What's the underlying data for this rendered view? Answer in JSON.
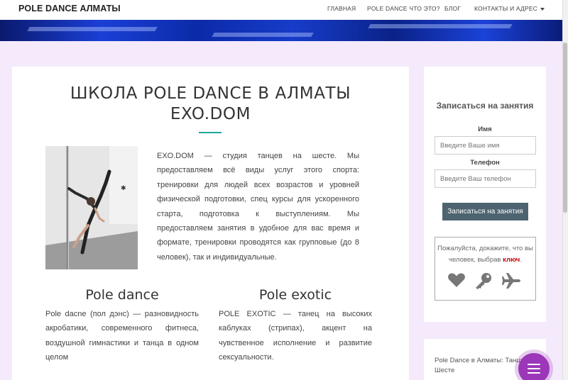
{
  "header": {
    "brand": "POLE DANCE АЛМАТЫ",
    "nav": [
      {
        "label": "ГЛАВНАЯ"
      },
      {
        "label": "POLE DANCE ЧТО ЭТО?"
      },
      {
        "label": "БЛОГ"
      },
      {
        "label": "КОНТАКТЫ И АДРЕС"
      }
    ]
  },
  "main": {
    "title_line1": "ШКОЛА POLE DANCE В АЛМАТЫ",
    "title_line2": "EXO.DOM",
    "intro": "EXO.DOM — студия танцев на шесте. Мы предоставляем всё виды услуг этого спорта: тренировки для людей всех возрастов и уровней физической подготовки, спец курсы для ускоренного старта, подготовка к выступлениям. Мы предоставляем занятия в удобное для вас время и формате, тренировки проводятся как групповые (до 8 человек), так и индивидуальные.",
    "sections": [
      {
        "heading": "Pole dance",
        "text": "Pole dacne (пол дэнс) — разновидность акробатики, современного фитнеса, воздушной гимнастики и танца в одном целом"
      },
      {
        "heading": "Pole exotic",
        "text": "POLE EXOTIC — танец на высоких каблуках (стрипах), акцент на чувственное исполнение и развитие сексуальности."
      }
    ]
  },
  "signup": {
    "title": "Записаться на занятия",
    "name_label": "Имя",
    "name_placeholder": "Введите Ваше имя",
    "phone_label": "Телефон",
    "phone_placeholder": "Введите Ваш телефон",
    "submit_label": "Записаться на занятия",
    "captcha": {
      "text_before": "Пожалуйста, докажите, что вы человек, выбрав ",
      "key_word": "ключ",
      "text_after": ".",
      "icons": [
        "heart-icon",
        "key-icon",
        "airplane-icon"
      ]
    }
  },
  "sidebar2": {
    "link": "Pole Dance в Алматы: Танцы на Шесте"
  },
  "colors": {
    "page_bg": "#f4eafb",
    "accent_teal": "#1aa89c",
    "submit_bg": "#4d6470",
    "fab_purple": "#9b37b8",
    "captcha_key": "#cc0000"
  }
}
